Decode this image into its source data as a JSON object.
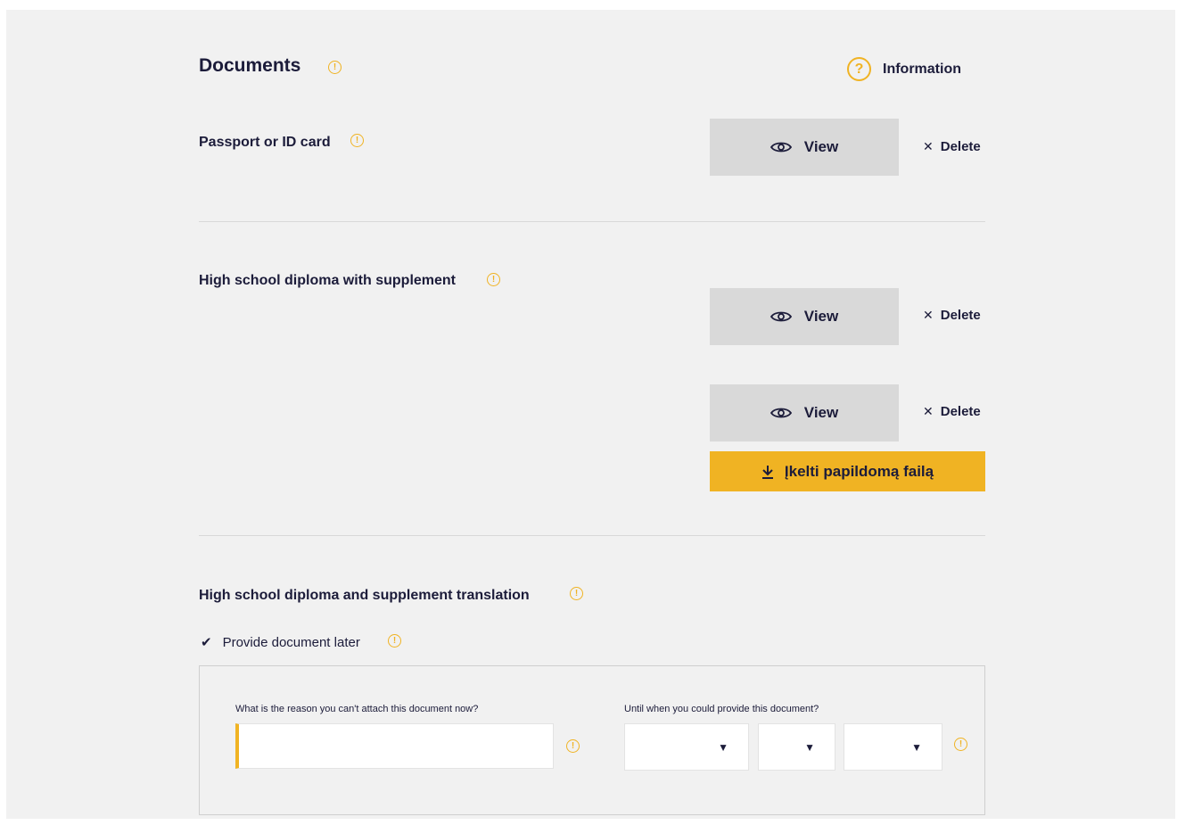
{
  "header": {
    "title": "Documents",
    "info_label": "Information",
    "help_glyph": "?",
    "warn_glyph": "!"
  },
  "sections": {
    "passport": {
      "label": "Passport or ID card",
      "view_label": "View",
      "delete_label": "Delete"
    },
    "diploma": {
      "label": "High school diploma with supplement",
      "files": [
        {
          "view_label": "View",
          "delete_label": "Delete"
        },
        {
          "view_label": "View",
          "delete_label": "Delete"
        }
      ],
      "upload_label": "Įkelti papildomą failą"
    },
    "translation": {
      "label": "High school diploma and supplement translation",
      "checkbox_label": "Provide document later",
      "checkbox_checked": true,
      "reason_label": "What is the reason you can't attach this document now?",
      "reason_value": "",
      "date_label": "Until when you could provide this document?",
      "date_selects": [
        "",
        "",
        ""
      ]
    }
  },
  "icons": {
    "warn": "warning-circle-icon",
    "help": "question-circle-icon",
    "eye": "eye-icon",
    "delete": "close-icon",
    "upload": "download-arrow-icon",
    "checkmark": "checkmark-icon",
    "chevron": "chevron-down-icon"
  },
  "colors": {
    "accent": "#f0b323",
    "text": "#1c1c3a",
    "background": "#f1f1f1",
    "button_gray": "#d9d9d9"
  }
}
